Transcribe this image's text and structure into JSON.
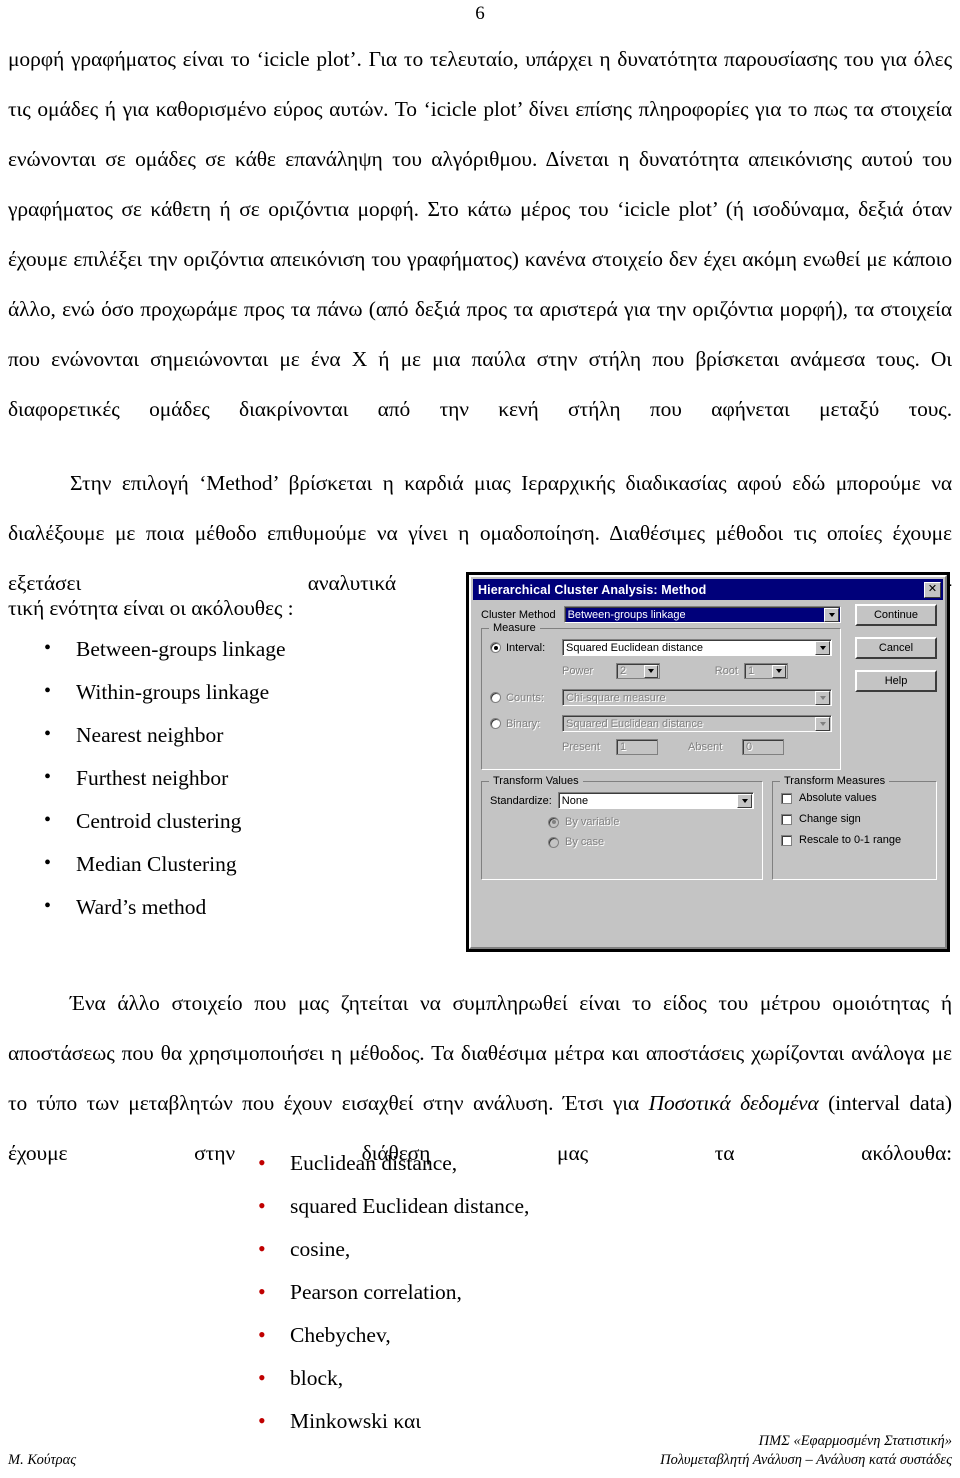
{
  "page": {
    "number": "6"
  },
  "paragraphs": {
    "p1": "μορφή γραφήματος είναι το ‘icicle plot’. Για το τελευταίο, υπάρχει η δυνατότητα παρουσίασης του για όλες τις ομάδες ή για καθορισμένο εύρος αυτών. Το ‘icicle plot’ δίνει επίσης πληροφορίες για το πως τα στοιχεία ενώνονται σε ομάδες σε κάθε επανάληψη του αλγόριθμου. Δίνεται η δυνατότητα απεικόνισης αυτού του γραφήματος σε κάθετη ή σε οριζόντια μορφή. Στο κάτω μέρος του ‘icicle plot’ (ή ισοδύναμα, δεξιά όταν έχουμε επιλέξει την οριζόντια απεικόνιση του γραφήματος) κανένα στοιχείο δεν έχει ακόμη ενωθεί με κάποιο άλλο, ενώ όσο προχωράμε προς τα πάνω (από δεξιά προς τα αριστερά για την οριζόντια μορφή), τα στοιχεία που ενώνονται σημειώνονται με ένα Χ ή με μια παύλα στην στήλη που βρίσκεται ανάμεσα τους. Οι διαφορετικές ομάδες διακρίνονται από την κενή στήλη που αφήνεται μεταξύ τους.",
    "p2": "Στην επιλογή ‘Method’ βρίσκεται η καρδιά μιας Ιεραρχικής διαδικασίας αφού εδώ μπορούμε να διαλέξουμε με ποια μέθοδο επιθυμούμε να γίνει η ομαδοποίηση. Διαθέσιμες μέθοδοι τις οποίες έχουμε εξετάσει αναλυτικά στην θεωρη-",
    "p2b": "τική ενότητα είναι οι ακόλουθες :",
    "p3_before_italic": "Ένα άλλο στοιχείο που μας ζητείται να συμπληρωθεί είναι το είδος του μέτρου ομοιότητας ή αποστάσεως που θα χρησιμοποιήσει η μέθοδος. Τα διαθέσιμα μέτρα και αποστάσεις χωρίζονται ανάλογα με το τύπο των μεταβλητών που έχουν εισαχθεί στην ανάλυση. Έτσι για ",
    "p3_italic": "Ποσοτικά δεδομένα",
    "p3_after_italic": " (interval data) έχουμε στην διάθεση μας τα ακόλουθα:"
  },
  "methods_list": [
    "Between-groups linkage",
    "Within-groups linkage",
    "Nearest neighbor",
    "Furthest neighbor",
    "Centroid clustering",
    "Median Clustering",
    "Ward’s method"
  ],
  "measures_list": [
    "Euclidean distance,",
    "squared Euclidean distance,",
    "cosine,",
    "Pearson correlation,",
    "Chebychev,",
    "block,",
    "Minkowski και"
  ],
  "dialog": {
    "title": "Hierarchical Cluster Analysis: Method",
    "close_label": "✕",
    "cluster_method": {
      "label": "Cluster Method",
      "value": "Between-groups linkage"
    },
    "buttons": {
      "continue": "Continue",
      "cancel": "Cancel",
      "help": "Help"
    },
    "measure": {
      "legend": "Measure",
      "interval_label": "Interval:",
      "interval_value": "Squared Euclidean distance",
      "power_label": "Power",
      "power_value": "2",
      "root_label": "Root",
      "root_value": "1",
      "counts_label": "Counts:",
      "counts_value": "Chi-square measure",
      "binary_label": "Binary:",
      "binary_value": "Squared Euclidean distance",
      "present_label": "Present",
      "present_value": "1",
      "absent_label": "Absent",
      "absent_value": "0"
    },
    "transform_values": {
      "legend": "Transform Values",
      "standardize_label": "Standardize:",
      "standardize_value": "None",
      "by_variable_label": "By variable",
      "by_case_label": "By case"
    },
    "transform_measures": {
      "legend": "Transform Measures",
      "absolute_values_label": "Absolute values",
      "change_sign_label": "Change sign",
      "rescale_label": "Rescale to 0-1 range"
    }
  },
  "footer": {
    "author": "Μ. Κούτρας",
    "program": "ΠΜΣ «Εφαρμοσμένη Στατιστική»",
    "course": "Πολυμεταβλητή Ανάλυση – Ανάλυση κατά συστάδες"
  },
  "colors": {
    "titlebar": "#000080",
    "dialog_face": "#c0c0c0",
    "red_bullet": "#c00000"
  }
}
